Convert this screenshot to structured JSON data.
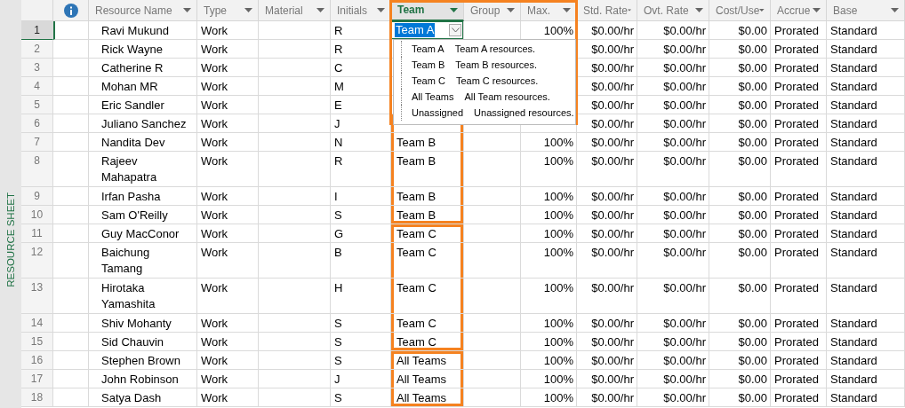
{
  "side_label": "RESOURCE SHEET",
  "columns": [
    {
      "kind": "info"
    },
    {
      "kind": "text",
      "label": "Resource Name",
      "selected": false
    },
    {
      "kind": "text",
      "label": "Type",
      "selected": false
    },
    {
      "kind": "text",
      "label": "Material",
      "selected": false
    },
    {
      "kind": "text",
      "label": "Initials",
      "selected": false
    },
    {
      "kind": "text",
      "label": "Team",
      "selected": true
    },
    {
      "kind": "text",
      "label": "Group",
      "selected": false
    },
    {
      "kind": "text",
      "label": "Max.",
      "selected": false
    },
    {
      "kind": "text",
      "label": "Std. Rate",
      "selected": false
    },
    {
      "kind": "text",
      "label": "Ovt. Rate",
      "selected": false
    },
    {
      "kind": "text",
      "label": "Cost/Use",
      "selected": false
    },
    {
      "kind": "text",
      "label": "Accrue",
      "selected": false
    },
    {
      "kind": "text",
      "label": "Base",
      "selected": false
    }
  ],
  "rows": [
    {
      "id": "1",
      "name": "Ravi Mukund",
      "type": "Work",
      "initials": "R",
      "team": "Team A",
      "max": "100%",
      "std_rate": "$0.00/hr",
      "ovt_rate": "$0.00/hr",
      "cost_use": "$0.00",
      "accrue": "Prorated",
      "base": "Standard",
      "selected": true,
      "highlighted": false
    },
    {
      "id": "2",
      "name": "Rick Wayne",
      "type": "Work",
      "initials": "R",
      "std_rate": "$0.00/hr",
      "ovt_rate": "$0.00/hr",
      "cost_use": "$0.00",
      "accrue": "Prorated",
      "base": "Standard",
      "selected": false,
      "highlighted": false
    },
    {
      "id": "3",
      "name": "Catherine R",
      "type": "Work",
      "initials": "C",
      "std_rate": "$0.00/hr",
      "ovt_rate": "$0.00/hr",
      "cost_use": "$0.00",
      "accrue": "Prorated",
      "base": "Standard",
      "selected": false,
      "highlighted": false
    },
    {
      "id": "4",
      "name": "Mohan MR",
      "type": "Work",
      "initials": "M",
      "std_rate": "$0.00/hr",
      "ovt_rate": "$0.00/hr",
      "cost_use": "$0.00",
      "accrue": "Prorated",
      "base": "Standard",
      "selected": false,
      "highlighted": false
    },
    {
      "id": "5",
      "name": "Eric Sandler",
      "type": "Work",
      "initials": "E",
      "std_rate": "$0.00/hr",
      "ovt_rate": "$0.00/hr",
      "cost_use": "$0.00",
      "accrue": "Prorated",
      "base": "Standard",
      "selected": false,
      "highlighted": false
    },
    {
      "id": "6",
      "name": "Juliano Sanchez",
      "type": "Work",
      "initials": "J",
      "std_rate": "$0.00/hr",
      "ovt_rate": "$0.00/hr",
      "cost_use": "$0.00",
      "accrue": "Prorated",
      "base": "Standard",
      "selected": false,
      "highlighted": true
    },
    {
      "id": "7",
      "name": "Nandita Dev",
      "type": "Work",
      "initials": "N",
      "team": "Team B",
      "max": "100%",
      "std_rate": "$0.00/hr",
      "ovt_rate": "$0.00/hr",
      "cost_use": "$0.00",
      "accrue": "Prorated",
      "base": "Standard",
      "selected": false,
      "highlighted": true
    },
    {
      "id": "8",
      "name": "Rajeev\nMahapatra",
      "type": "Work",
      "initials": "R",
      "team": "Team B",
      "max": "100%",
      "std_rate": "$0.00/hr",
      "ovt_rate": "$0.00/hr",
      "cost_use": "$0.00",
      "accrue": "Prorated",
      "base": "Standard",
      "selected": false,
      "highlighted": true
    },
    {
      "id": "9",
      "name": "Irfan Pasha",
      "type": "Work",
      "initials": "I",
      "team": "Team B",
      "max": "100%",
      "std_rate": "$0.00/hr",
      "ovt_rate": "$0.00/hr",
      "cost_use": "$0.00",
      "accrue": "Prorated",
      "base": "Standard",
      "selected": false,
      "highlighted": true
    },
    {
      "id": "10",
      "name": "Sam O'Reilly",
      "type": "Work",
      "initials": "S",
      "team": "Team B",
      "max": "100%",
      "std_rate": "$0.00/hr",
      "ovt_rate": "$0.00/hr",
      "cost_use": "$0.00",
      "accrue": "Prorated",
      "base": "Standard",
      "selected": false,
      "highlighted": true
    },
    {
      "id": "11",
      "name": "Guy MacConor",
      "type": "Work",
      "initials": "G",
      "team": "Team C",
      "max": "100%",
      "std_rate": "$0.00/hr",
      "ovt_rate": "$0.00/hr",
      "cost_use": "$0.00",
      "accrue": "Prorated",
      "base": "Standard",
      "selected": false,
      "highlighted": true
    },
    {
      "id": "12",
      "name": "Baichung\nTamang",
      "type": "Work",
      "initials": "B",
      "team": "Team C",
      "max": "100%",
      "std_rate": "$0.00/hr",
      "ovt_rate": "$0.00/hr",
      "cost_use": "$0.00",
      "accrue": "Prorated",
      "base": "Standard",
      "selected": false,
      "highlighted": true
    },
    {
      "id": "13",
      "name": "Hirotaka\nYamashita",
      "type": "Work",
      "initials": "H",
      "team": "Team C",
      "max": "100%",
      "std_rate": "$0.00/hr",
      "ovt_rate": "$0.00/hr",
      "cost_use": "$0.00",
      "accrue": "Prorated",
      "base": "Standard",
      "selected": false,
      "highlighted": true
    },
    {
      "id": "14",
      "name": "Shiv Mohanty",
      "type": "Work",
      "initials": "S",
      "team": "Team C",
      "max": "100%",
      "std_rate": "$0.00/hr",
      "ovt_rate": "$0.00/hr",
      "cost_use": "$0.00",
      "accrue": "Prorated",
      "base": "Standard",
      "selected": false,
      "highlighted": true
    },
    {
      "id": "15",
      "name": "Sid Chauvin",
      "type": "Work",
      "initials": "S",
      "team": "Team C",
      "max": "100%",
      "std_rate": "$0.00/hr",
      "ovt_rate": "$0.00/hr",
      "cost_use": "$0.00",
      "accrue": "Prorated",
      "base": "Standard",
      "selected": false,
      "highlighted": true
    },
    {
      "id": "16",
      "name": "Stephen Brown",
      "type": "Work",
      "initials": "S",
      "team": "All Teams",
      "max": "100%",
      "std_rate": "$0.00/hr",
      "ovt_rate": "$0.00/hr",
      "cost_use": "$0.00",
      "accrue": "Prorated",
      "base": "Standard",
      "selected": false,
      "highlighted": true
    },
    {
      "id": "17",
      "name": "John Robinson",
      "type": "Work",
      "initials": "J",
      "team": "All Teams",
      "max": "100%",
      "std_rate": "$0.00/hr",
      "ovt_rate": "$0.00/hr",
      "cost_use": "$0.00",
      "accrue": "Prorated",
      "base": "Standard",
      "selected": false,
      "highlighted": true
    },
    {
      "id": "18",
      "name": "Satya Dash",
      "type": "Work",
      "initials": "S",
      "team": "All Teams",
      "max": "100%",
      "std_rate": "$0.00/hr",
      "ovt_rate": "$0.00/hr",
      "cost_use": "$0.00",
      "accrue": "Prorated",
      "base": "Standard",
      "selected": false,
      "highlighted": true
    }
  ],
  "dropdown": {
    "highlighted": true,
    "items": [
      {
        "value": "Team A",
        "description": "Team A resources."
      },
      {
        "value": "Team B",
        "description": "Team B resources."
      },
      {
        "value": "Team C",
        "description": "Team C resources."
      },
      {
        "value": "All Teams",
        "description": "All Team resources."
      },
      {
        "value": "Unassigned",
        "description": "Unassigned resources."
      }
    ]
  }
}
